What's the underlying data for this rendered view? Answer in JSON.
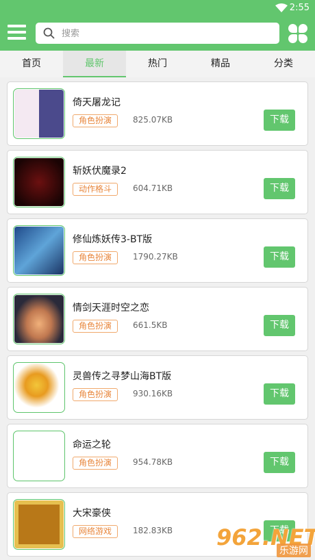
{
  "status": {
    "time": "2:55"
  },
  "search": {
    "placeholder": "搜索"
  },
  "tabs": [
    {
      "label": "首页"
    },
    {
      "label": "最新"
    },
    {
      "label": "热门"
    },
    {
      "label": "精品"
    },
    {
      "label": "分类"
    }
  ],
  "apps": [
    {
      "name": "倚天屠龙记",
      "tag": "角色扮演",
      "size": "825.07KB",
      "download": "下载"
    },
    {
      "name": "斩妖伏魔录2",
      "tag": "动作格斗",
      "size": "604.71KB",
      "download": "下载"
    },
    {
      "name": "修仙炼妖传3-BT版",
      "tag": "角色扮演",
      "size": "1790.27KB",
      "download": "下载"
    },
    {
      "name": "情剑天涯时空之恋",
      "tag": "角色扮演",
      "size": "661.5KB",
      "download": "下载"
    },
    {
      "name": "灵兽传之寻梦山海BT版",
      "tag": "角色扮演",
      "size": "930.16KB",
      "download": "下载"
    },
    {
      "name": "命运之轮",
      "tag": "角色扮演",
      "size": "954.78KB",
      "download": "下载"
    },
    {
      "name": "大宋豪侠",
      "tag": "网络游戏",
      "size": "182.83KB",
      "download": "下载"
    }
  ],
  "watermark": {
    "number": "962.NET",
    "site": "乐游网"
  },
  "colors": {
    "accent": "#62c66e",
    "tag": "#e8873d"
  }
}
